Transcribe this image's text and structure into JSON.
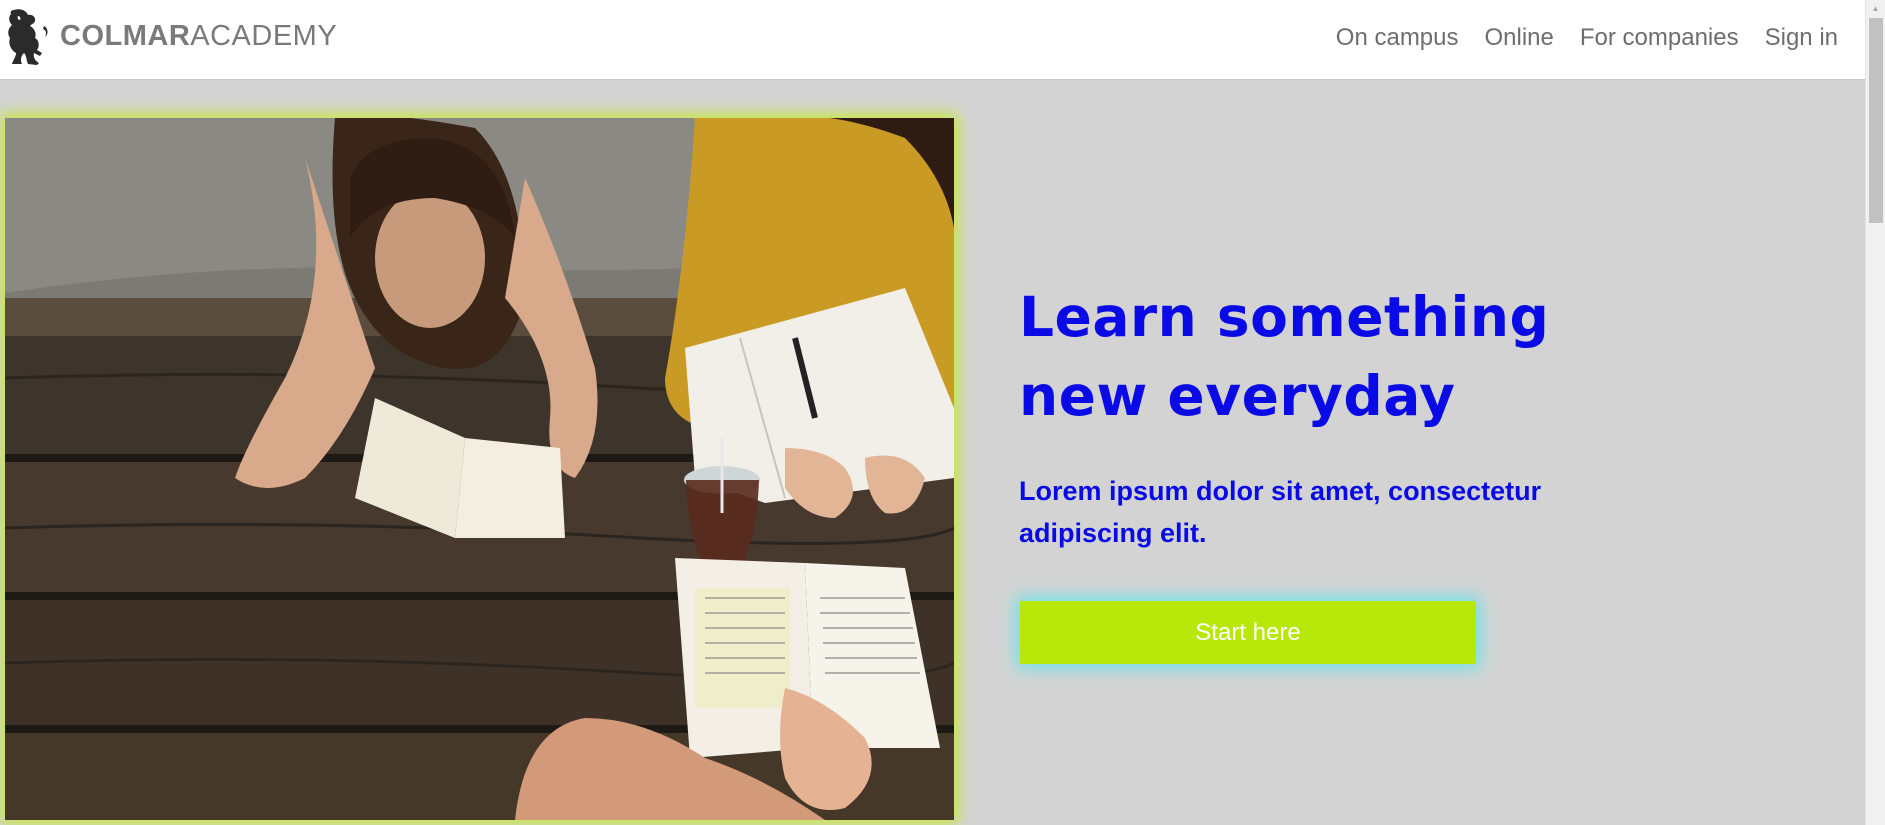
{
  "header": {
    "logo": {
      "text_bold": "COLMAR",
      "text_light": "ACADEMY",
      "icon": "lion-rampant-icon"
    },
    "nav": [
      {
        "label": "On campus"
      },
      {
        "label": "Online"
      },
      {
        "label": "For companies"
      },
      {
        "label": "Sign in"
      }
    ]
  },
  "hero": {
    "image": "students-studying-at-wooden-table",
    "headline_line1": "Learn something",
    "headline_line2": "new everyday",
    "subtext_line1": "Lorem ipsum dolor sit amet, consectetur",
    "subtext_line2": "adipiscing elit.",
    "cta_label": "Start here"
  },
  "colors": {
    "page_background": "#d3d3d3",
    "header_background": "#ffffff",
    "headline": "#0a0ae6",
    "cta_background": "#b8e80a",
    "cta_glow": "#6fe3e8",
    "image_glow": "#c6e83a",
    "nav_text": "#6e6e6e"
  }
}
